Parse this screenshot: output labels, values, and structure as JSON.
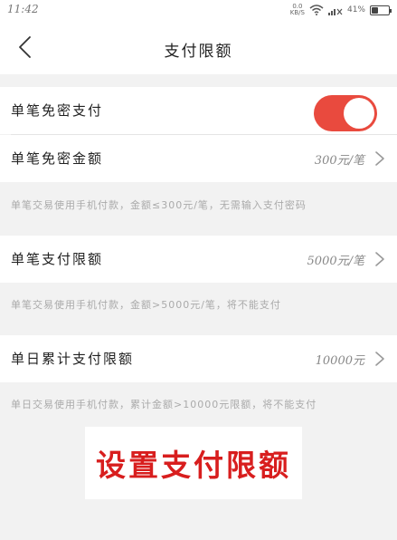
{
  "status_bar": {
    "time": "11:42",
    "speed_value": "0.0",
    "speed_unit": "KB/S",
    "battery": "41%"
  },
  "header": {
    "title": "支付限额"
  },
  "settings": {
    "single_free_pay": {
      "label": "单笔免密支付",
      "enabled": true
    },
    "single_free_amount": {
      "label": "单笔免密金额",
      "value": "300元/笔"
    },
    "single_free_note": "单笔交易使用手机付款，金额≤300元/笔，无需输入支付密码",
    "single_limit": {
      "label": "单笔支付限额",
      "value": "5000元/笔"
    },
    "single_limit_note": "单笔交易使用手机付款，金额>5000元/笔，将不能支付",
    "daily_limit": {
      "label": "单日累计支付限额",
      "value": "10000元"
    },
    "daily_limit_note": "单日交易使用手机付款，累计金额>10000元限额，将不能支付"
  },
  "banner": {
    "text": "设置支付限额"
  },
  "colors": {
    "accent": "#e94a3e",
    "banner_text": "#d81e1e",
    "background": "#f2f2f2"
  },
  "icons": [
    "back-arrow-icon",
    "chevron-right-icon",
    "wifi-icon",
    "signal-icon",
    "battery-icon"
  ]
}
